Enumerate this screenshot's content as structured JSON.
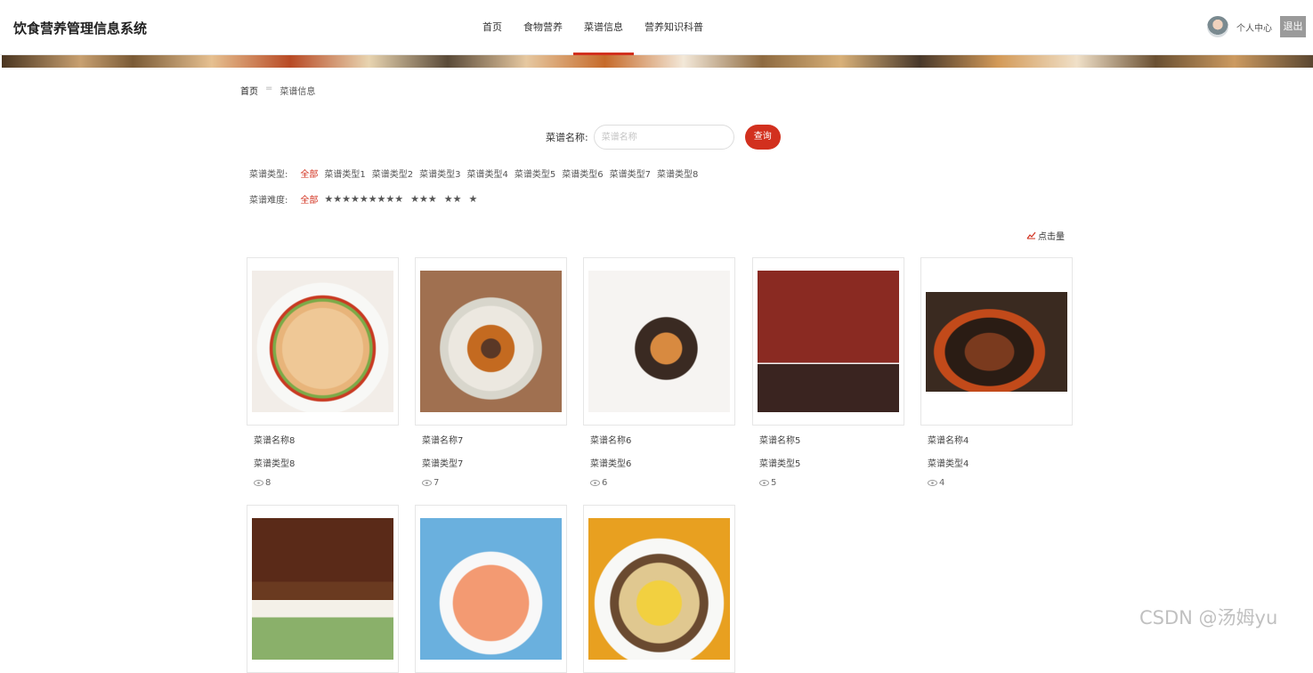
{
  "header": {
    "app_title": "饮食营养管理信息系统",
    "nav": [
      {
        "label": "首页",
        "active": false
      },
      {
        "label": "食物营养",
        "active": false
      },
      {
        "label": "菜谱信息",
        "active": true
      },
      {
        "label": "营养知识科普",
        "active": false
      }
    ],
    "user_center": "个人中心",
    "logout": "退出"
  },
  "breadcrumb": {
    "home": "首页",
    "separator": "=",
    "current": "菜谱信息"
  },
  "search": {
    "label": "菜谱名称:",
    "placeholder": "菜谱名称",
    "value": "",
    "button": "查询"
  },
  "filters": {
    "type": {
      "label": "菜谱类型:",
      "options": [
        "全部",
        "菜谱类型1",
        "菜谱类型2",
        "菜谱类型3",
        "菜谱类型4",
        "菜谱类型5",
        "菜谱类型6",
        "菜谱类型7",
        "菜谱类型8"
      ],
      "selected": "全部"
    },
    "difficulty": {
      "label": "菜谱难度:",
      "all": "全部",
      "options": [
        "★★★★★",
        "★★★★",
        "★★★",
        "★★",
        "★"
      ]
    }
  },
  "sort": {
    "label": "点击量",
    "icon": "trend-icon"
  },
  "recipes": [
    {
      "name": "菜谱名称8",
      "type": "菜谱类型8",
      "views": "8"
    },
    {
      "name": "菜谱名称7",
      "type": "菜谱类型7",
      "views": "7"
    },
    {
      "name": "菜谱名称6",
      "type": "菜谱类型6",
      "views": "6"
    },
    {
      "name": "菜谱名称5",
      "type": "菜谱类型5",
      "views": "5"
    },
    {
      "name": "菜谱名称4",
      "type": "菜谱类型4",
      "views": "4"
    },
    {
      "name": "",
      "type": "",
      "views": ""
    },
    {
      "name": "",
      "type": "",
      "views": ""
    },
    {
      "name": "",
      "type": "",
      "views": ""
    }
  ],
  "colors": {
    "accent": "#d2301e"
  },
  "watermark": "CSDN @汤姆yu"
}
